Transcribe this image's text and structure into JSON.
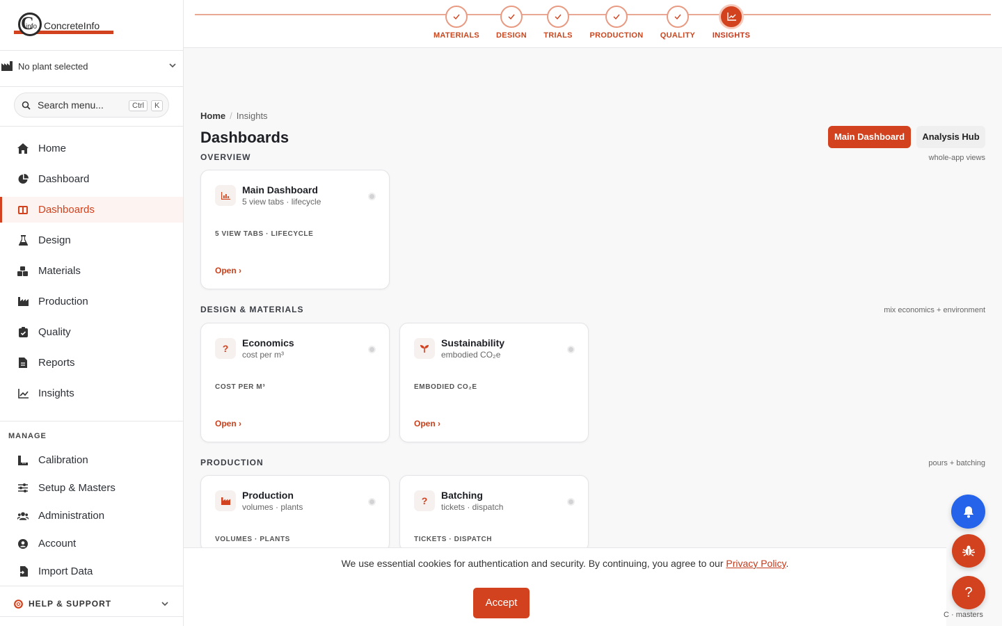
{
  "logo": {
    "letter": "C",
    "small": "info",
    "name": "ConcreteInfo"
  },
  "plant": {
    "label": "No plant selected"
  },
  "search": {
    "placeholder": "Search menu...",
    "kbd1": "Ctrl",
    "kbd2": "K"
  },
  "nav": [
    {
      "label": "Home",
      "icon": "home-icon"
    },
    {
      "label": "Dashboard",
      "icon": "pie-chart-icon"
    },
    {
      "label": "Dashboards",
      "icon": "columns-icon",
      "active": true
    },
    {
      "label": "Design",
      "icon": "flask-icon"
    },
    {
      "label": "Materials",
      "icon": "cubes-icon"
    },
    {
      "label": "Production",
      "icon": "factory-icon"
    },
    {
      "label": "Quality",
      "icon": "clipboard-check-icon"
    },
    {
      "label": "Reports",
      "icon": "document-icon"
    },
    {
      "label": "Insights",
      "icon": "line-chart-icon"
    }
  ],
  "manage": {
    "label": "MANAGE",
    "items": [
      {
        "label": "Calibration",
        "icon": "ruler-icon"
      },
      {
        "label": "Setup & Masters",
        "icon": "sliders-icon"
      },
      {
        "label": "Administration",
        "icon": "users-icon"
      },
      {
        "label": "Account",
        "icon": "user-circle-icon"
      },
      {
        "label": "Import Data",
        "icon": "file-import-icon"
      }
    ]
  },
  "help": {
    "label": "HELP & SUPPORT"
  },
  "steps": [
    {
      "label": "MATERIALS",
      "state": "done"
    },
    {
      "label": "DESIGN",
      "state": "done"
    },
    {
      "label": "TRIALS",
      "state": "done"
    },
    {
      "label": "PRODUCTION",
      "state": "done"
    },
    {
      "label": "QUALITY",
      "state": "done"
    },
    {
      "label": "INSIGHTS",
      "state": "current"
    }
  ],
  "breadcrumb": {
    "home": "Home",
    "sep": "/",
    "current": "Insights"
  },
  "page": {
    "title": "Dashboards",
    "primary_button": "Main Dashboard",
    "secondary_button": "Analysis Hub"
  },
  "sections": {
    "overview": {
      "title": "OVERVIEW",
      "note": "whole-app views"
    },
    "design": {
      "title": "DESIGN & MATERIALS",
      "note": "mix economics + environment"
    },
    "production": {
      "title": "PRODUCTION",
      "note": "pours + batching"
    }
  },
  "cards": {
    "main": {
      "title": "Main Dashboard",
      "sub": "5 view tabs · lifecycle",
      "tag": "5 VIEW TABS · LIFECYCLE",
      "open": "Open ›"
    },
    "economics": {
      "icon_text": "?",
      "title": "Economics",
      "sub": "cost per m³",
      "tag": "COST PER M³",
      "open": "Open ›"
    },
    "sustainability": {
      "title": "Sustainability",
      "sub": "embodied CO₂e",
      "tag": "EMBODIED CO₂E",
      "open": "Open ›"
    },
    "production": {
      "title": "Production",
      "sub": "volumes · plants",
      "tag": "VOLUMES · PLANTS"
    },
    "batching": {
      "icon_text": "?",
      "title": "Batching",
      "sub": "tickets · dispatch",
      "tag": "TICKETS · DISPATCH"
    }
  },
  "cookie": {
    "text": "We use essential cookies for authentication and security. By continuing, you agree to our",
    "link": "Privacy Policy",
    "end": ".",
    "accept": "Accept"
  },
  "fab": {
    "help": "?"
  },
  "footnote": "C · masters",
  "colors": {
    "accent": "#d2421e",
    "bell": "#2563eb"
  }
}
